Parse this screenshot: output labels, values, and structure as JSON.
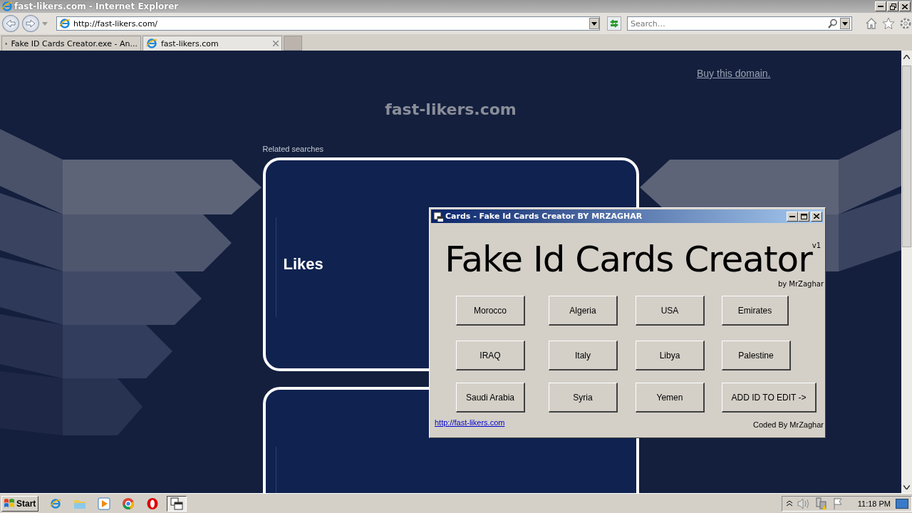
{
  "browser": {
    "title": "fast-likers.com - Internet Explorer",
    "address": "http://fast-likers.com/",
    "search_placeholder": "Search…",
    "tabs": [
      {
        "label": "Fake ID Cards Creator.exe - An...",
        "selected": false,
        "kind": "sandbox"
      },
      {
        "label": "fast-likers.com",
        "selected": true,
        "kind": "ie"
      }
    ]
  },
  "page": {
    "buy_link": "Buy this domain.",
    "domain": "fast-likers.com",
    "related_label": "Related searches",
    "cards": [
      {
        "kind": "full",
        "label": "Likes"
      },
      {
        "kind": "partial"
      }
    ]
  },
  "dialog": {
    "title": "Cards - Fake Id Cards Creator BY MRZAGHAR",
    "heading": "Fake Id Cards Creator",
    "version": "v1",
    "byline": "by MrZaghar",
    "buttons": [
      "Morocco",
      "Algeria",
      "USA",
      "Emirates",
      "IRAQ",
      "Italy",
      "Libya",
      "Palestine",
      "Saudi Arabia",
      "Syria",
      "Yemen",
      "ADD ID TO EDIT ->"
    ],
    "link": "http://fast-likers.com",
    "credit": "Coded By MrZaghar"
  },
  "taskbar": {
    "start": "Start",
    "clock": "11:18 PM",
    "apps": [
      {
        "kind": "ie",
        "selected": false
      },
      {
        "kind": "folder",
        "selected": false
      },
      {
        "kind": "media",
        "selected": false
      },
      {
        "kind": "chrome",
        "selected": false
      },
      {
        "kind": "opera",
        "selected": false
      },
      {
        "kind": "window",
        "selected": true
      }
    ]
  }
}
